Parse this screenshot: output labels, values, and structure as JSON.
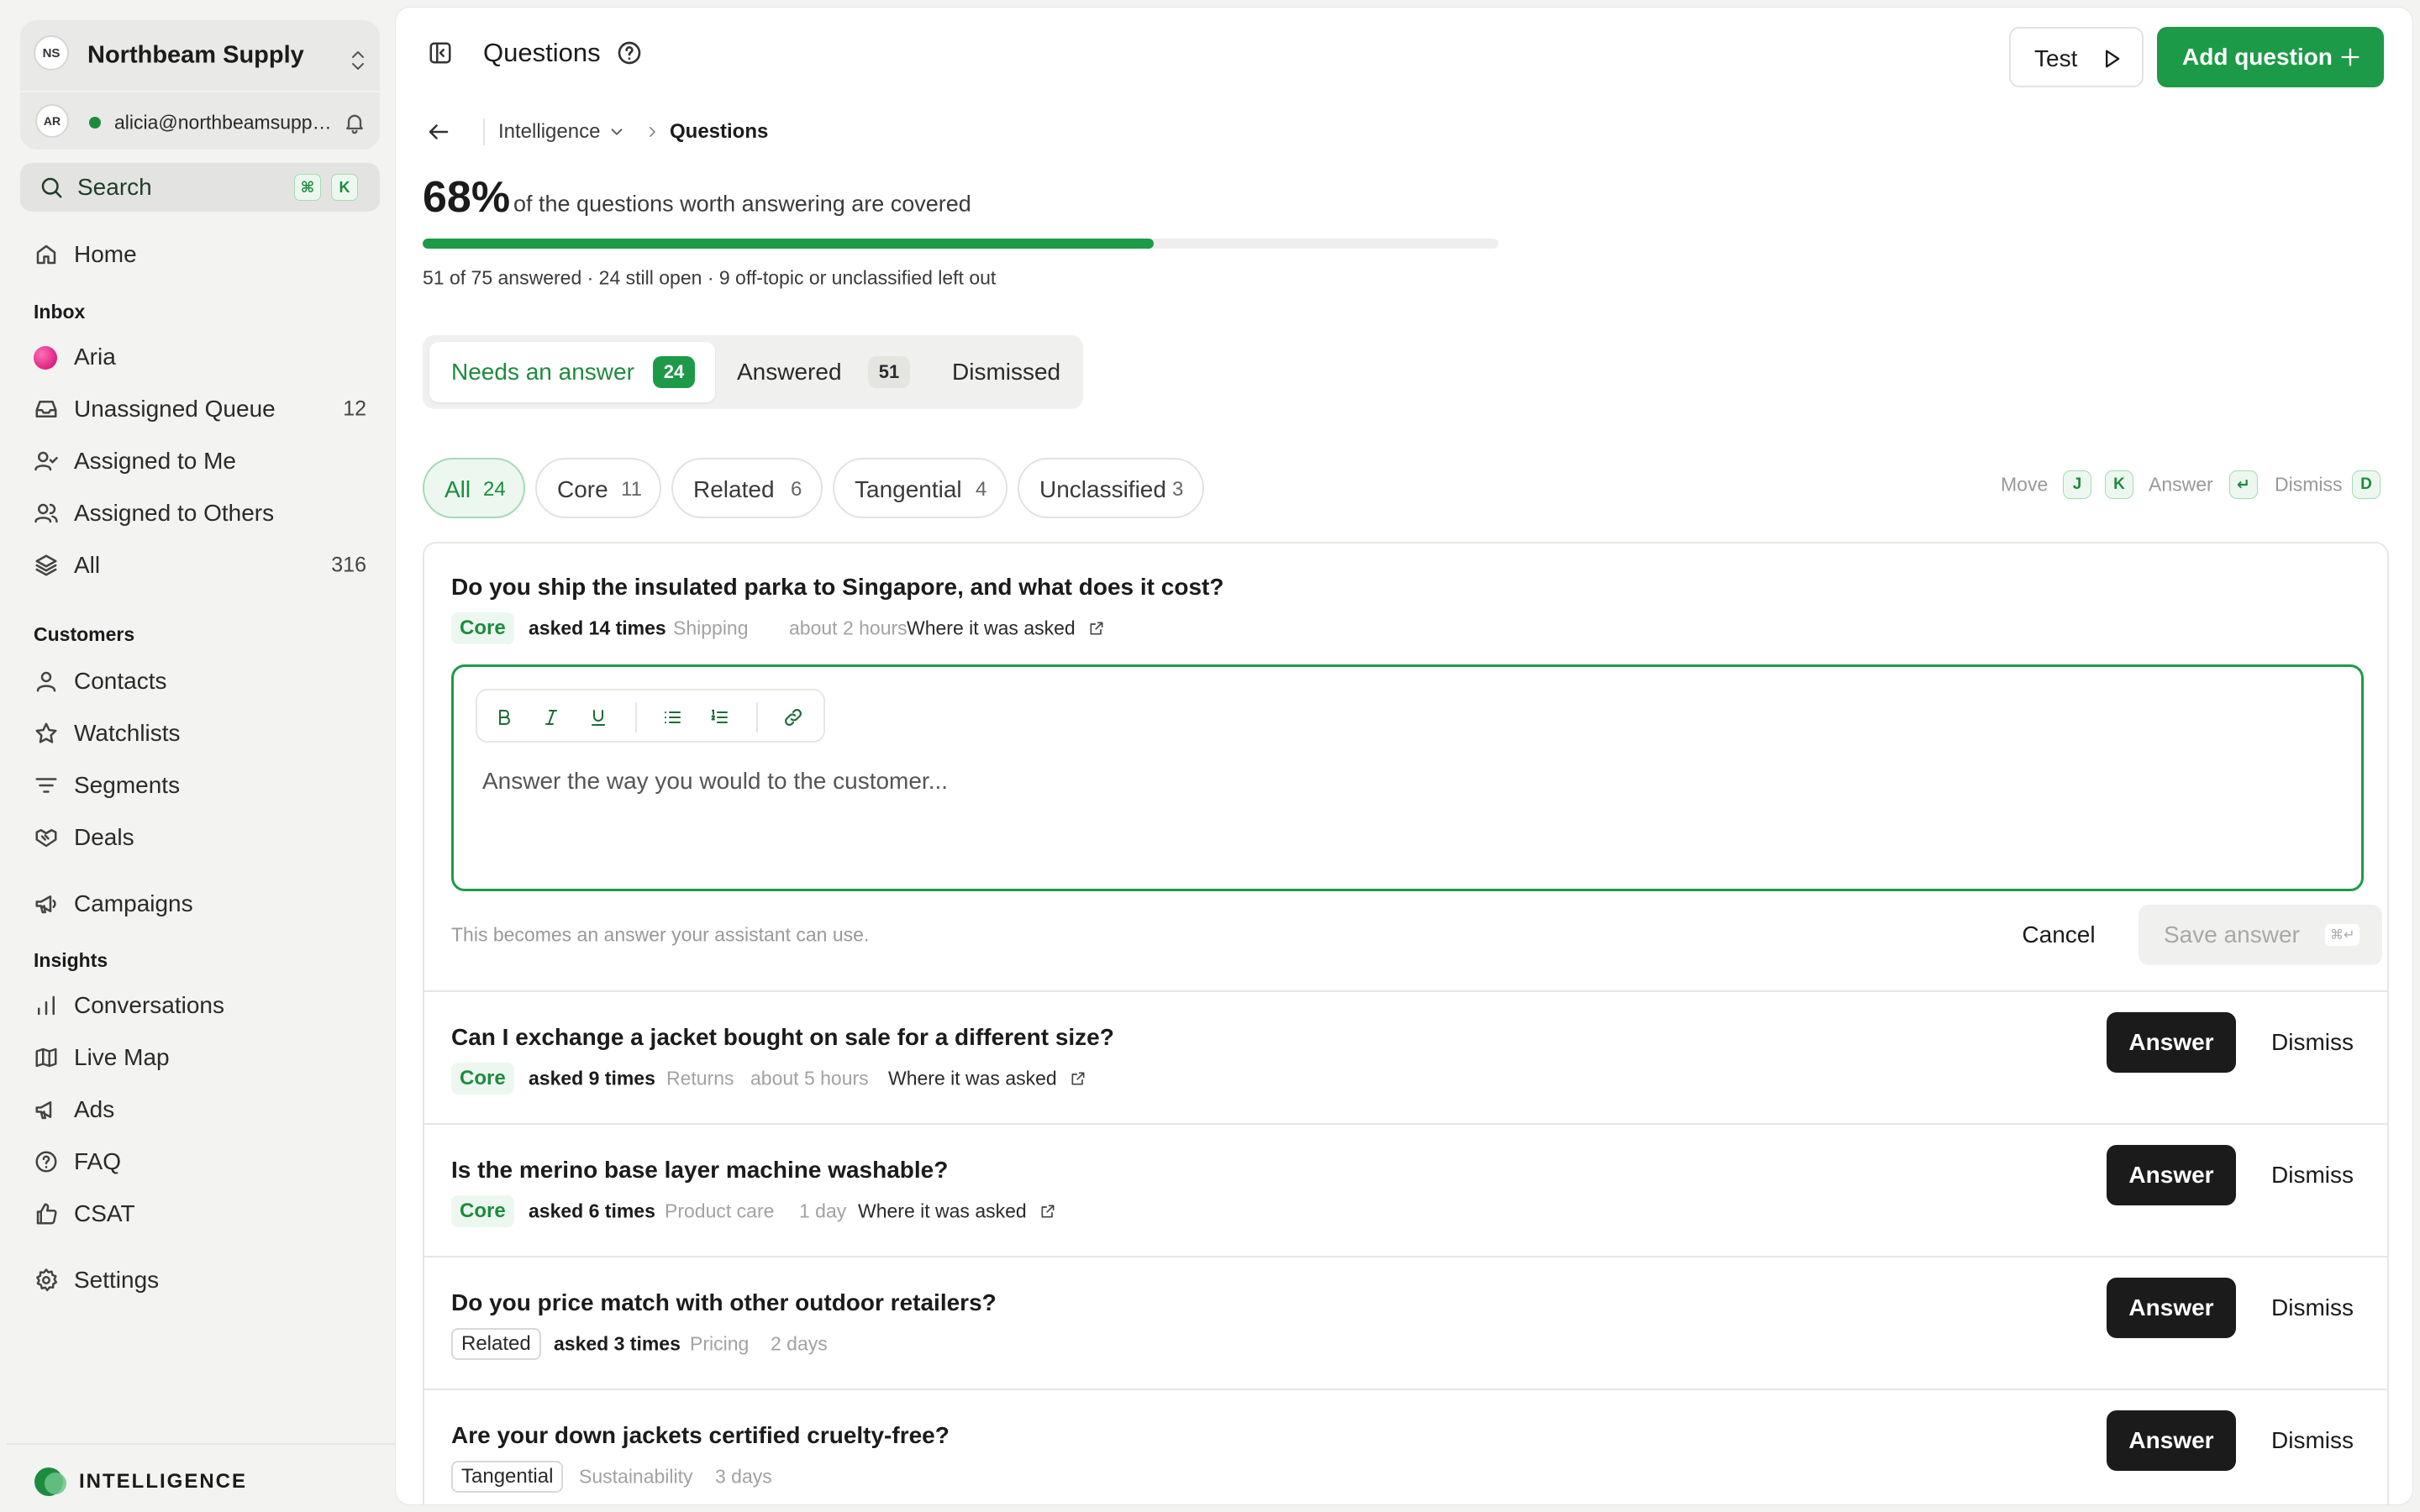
{
  "workspace": {
    "initials": "NS",
    "name": "Northbeam Supply"
  },
  "user": {
    "initials": "AR",
    "email": "alicia@northbeamsupply.com"
  },
  "search": {
    "label": "Search",
    "shortcut_mod": "⌘",
    "shortcut_key": "K"
  },
  "nav": {
    "home": "Home",
    "inbox_heading": "Inbox",
    "inbox": [
      {
        "label": "Aria",
        "count": ""
      },
      {
        "label": "Unassigned Queue",
        "count": "12"
      },
      {
        "label": "Assigned to Me",
        "count": ""
      },
      {
        "label": "Assigned to Others",
        "count": ""
      },
      {
        "label": "All",
        "count": "316"
      }
    ],
    "customers_heading": "Customers",
    "customers": [
      {
        "label": "Contacts"
      },
      {
        "label": "Watchlists"
      },
      {
        "label": "Segments"
      },
      {
        "label": "Deals"
      }
    ],
    "campaigns": "Campaigns",
    "insights_heading": "Insights",
    "insights": [
      {
        "label": "Conversations"
      },
      {
        "label": "Live Map"
      },
      {
        "label": "Ads"
      },
      {
        "label": "FAQ"
      },
      {
        "label": "CSAT"
      }
    ],
    "settings": "Settings"
  },
  "brand": {
    "label": "INTELLIGENCE"
  },
  "header": {
    "title": "Questions",
    "test_label": "Test",
    "add_label": "Add question"
  },
  "breadcrumb": {
    "parent": "Intelligence",
    "current": "Questions"
  },
  "coverage": {
    "percent_label": "68%",
    "percent_value": 0.68,
    "text": "of the questions worth answering are covered",
    "stats": "51 of 75 answered · 24 still open · 9 off-topic or unclassified left out"
  },
  "tabs": [
    {
      "label": "Needs an answer",
      "count": "24"
    },
    {
      "label": "Answered",
      "count": "51"
    },
    {
      "label": "Dismissed",
      "count": ""
    }
  ],
  "filters": [
    {
      "label": "All",
      "count": "24"
    },
    {
      "label": "Core",
      "count": "11"
    },
    {
      "label": "Related",
      "count": "6"
    },
    {
      "label": "Tangential",
      "count": "4"
    },
    {
      "label": "Unclassified",
      "count": "3"
    }
  ],
  "hints": {
    "move": "Move",
    "move_key1": "J",
    "move_key2": "K",
    "answer": "Answer",
    "answer_key": "↵",
    "dismiss": "Dismiss",
    "dismiss_key": "D"
  },
  "questions": [
    {
      "title": "Do you ship the insulated parka to Singapore, and what does it cost?",
      "tag": "Core",
      "asked": "asked 14 times",
      "topic": "Shipping",
      "age": "about 2 hours",
      "where": "Where it was asked"
    },
    {
      "title": "Can I exchange a jacket bought on sale for a different size?",
      "tag": "Core",
      "asked": "asked 9 times",
      "topic": "Returns",
      "age": "about 5 hours",
      "where": "Where it was asked"
    },
    {
      "title": "Is the merino base layer machine washable?",
      "tag": "Core",
      "asked": "asked 6 times",
      "topic": "Product care",
      "age": "1 day",
      "where": "Where it was asked"
    },
    {
      "title": "Do you price match with other outdoor retailers?",
      "tag": "Related",
      "asked": "asked 3 times",
      "topic": "Pricing",
      "age": "2 days",
      "where": ""
    },
    {
      "title": "Are your down jackets certified cruelty-free?",
      "tag": "Tangential",
      "asked": "",
      "topic": "Sustainability",
      "age": "3 days",
      "where": ""
    }
  ],
  "editor": {
    "placeholder": "Answer the way you would to the customer...",
    "help": "This becomes an answer your assistant can use.",
    "cancel": "Cancel",
    "save": "Save answer",
    "save_shortcut": "⌘↵"
  },
  "row_actions": {
    "answer": "Answer",
    "dismiss": "Dismiss"
  },
  "colors": {
    "accent": "#1d9a48",
    "accent_soft": "#ecf8ef",
    "dark_button": "#1b1b1b"
  }
}
